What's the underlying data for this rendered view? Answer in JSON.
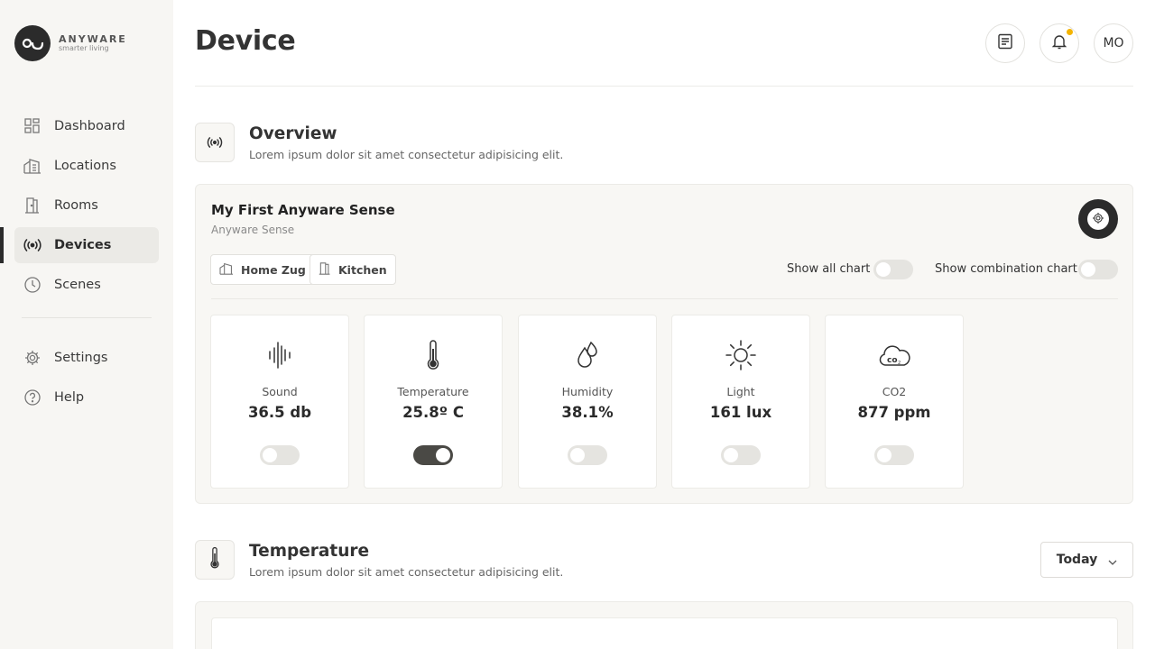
{
  "brand": {
    "name": "ANYWARE",
    "tagline": "smarter living"
  },
  "nav": {
    "items": [
      {
        "label": "Dashboard",
        "icon": "dashboard-icon"
      },
      {
        "label": "Locations",
        "icon": "building-icon"
      },
      {
        "label": "Rooms",
        "icon": "door-icon"
      },
      {
        "label": "Devices",
        "icon": "broadcast-icon",
        "active": true
      },
      {
        "label": "Scenes",
        "icon": "clock-icon"
      }
    ],
    "secondary": [
      {
        "label": "Settings",
        "icon": "gear-icon"
      },
      {
        "label": "Help",
        "icon": "help-icon"
      }
    ]
  },
  "header": {
    "title": "Device",
    "avatar": "MO",
    "notification_color": "#f4b400"
  },
  "overview": {
    "title": "Overview",
    "subtitle": "Lorem ipsum dolor sit amet consectetur adipisicing elit."
  },
  "device": {
    "name": "My First Anyware Sense",
    "type": "Anyware Sense",
    "location": "Home Zug",
    "room": "Kitchen",
    "show_all_chart_label": "Show all chart",
    "show_all_chart": false,
    "show_combination_label": "Show combination chart",
    "show_combination": false
  },
  "sensors": [
    {
      "label": "Sound",
      "value": "36.5 db",
      "icon": "sound-wave-icon",
      "enabled": false
    },
    {
      "label": "Temperature",
      "value": "25.8º C",
      "icon": "thermometer-icon",
      "enabled": true
    },
    {
      "label": "Humidity",
      "value": "38.1%",
      "icon": "droplets-icon",
      "enabled": false
    },
    {
      "label": "Light",
      "value": "161 lux",
      "icon": "sun-icon",
      "enabled": false
    },
    {
      "label": "CO2",
      "value": "877 ppm",
      "icon": "co2-cloud-icon",
      "enabled": false
    }
  ],
  "temperature": {
    "title": "Temperature",
    "subtitle": "Lorem ipsum dolor sit amet consectetur adipisicing elit.",
    "range": "Today"
  },
  "colors": {
    "accent": "#2b2b2b",
    "sidebar_bg": "#f7f6f3",
    "card_bg": "#f8f7f4"
  }
}
